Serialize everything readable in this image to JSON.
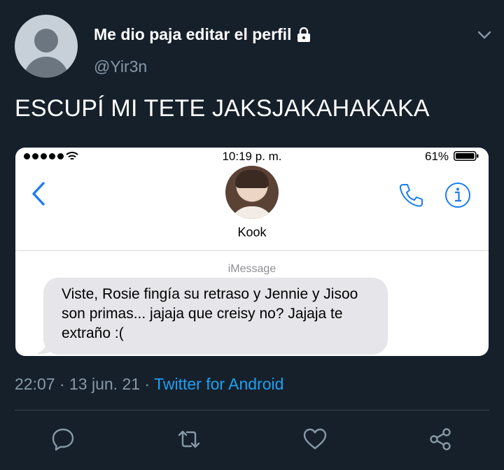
{
  "user": {
    "display_name": "Me dio paja editar el perfil",
    "handle": "@Yir3n"
  },
  "tweet": {
    "text": "ESCUPÍ MI TETE JAKSJAKAHAKAKA",
    "time": "22:07",
    "date": "13 jun. 21",
    "separator": " · ",
    "source": "Twitter for Android"
  },
  "screenshot": {
    "status_bar": {
      "time": "10:19 p. m.",
      "battery": "61%"
    },
    "contact_name": "Kook",
    "service_label": "iMessage",
    "message": "Viste, Rosie fingía su retraso y Jennie y Jisoo son primas... jajaja que creisy no? Jajaja te extraño :("
  },
  "actions": {
    "reply_icon": "reply-icon",
    "retweet_icon": "retweet-icon",
    "like_icon": "heart-icon",
    "share_icon": "share-icon"
  },
  "colors": {
    "background": "#15202b",
    "secondary_text": "#8899a6",
    "link": "#1da1f2",
    "ios_blue": "#1a7cf5"
  }
}
